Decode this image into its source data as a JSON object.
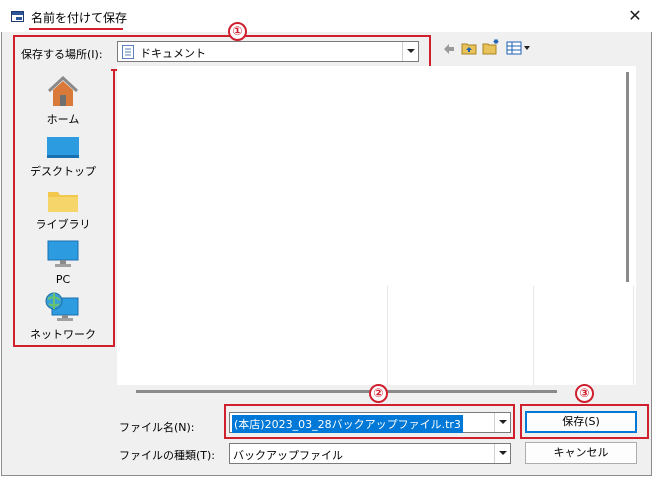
{
  "dialog": {
    "title": "名前を付けて保存",
    "close_glyph": "✕"
  },
  "location": {
    "label": "保存する場所(I):",
    "value": "ドキュメント"
  },
  "toolbar": {
    "icons": [
      "back-icon",
      "up-folder-icon",
      "new-folder-icon",
      "view-menu-icon"
    ]
  },
  "places": [
    {
      "label": "ホーム",
      "icon": "home-icon"
    },
    {
      "label": "デスクトップ",
      "icon": "desktop-icon"
    },
    {
      "label": "ライブラリ",
      "icon": "library-icon"
    },
    {
      "label": "PC",
      "icon": "pc-icon"
    },
    {
      "label": "ネットワーク",
      "icon": "network-icon"
    }
  ],
  "filename": {
    "label": "ファイル名(N):",
    "value": "(本店)2023_03_28バックアップファイル.tr3"
  },
  "filetype": {
    "label": "ファイルの種類(T):",
    "value": "バックアップファイル"
  },
  "buttons": {
    "save": "保存(S)",
    "cancel": "キャンセル"
  },
  "annotations": {
    "badge1": "①",
    "badge2": "②",
    "badge3": "③"
  },
  "colors": {
    "annotation_red": "#d0202e",
    "selection_blue": "#0078d7"
  }
}
